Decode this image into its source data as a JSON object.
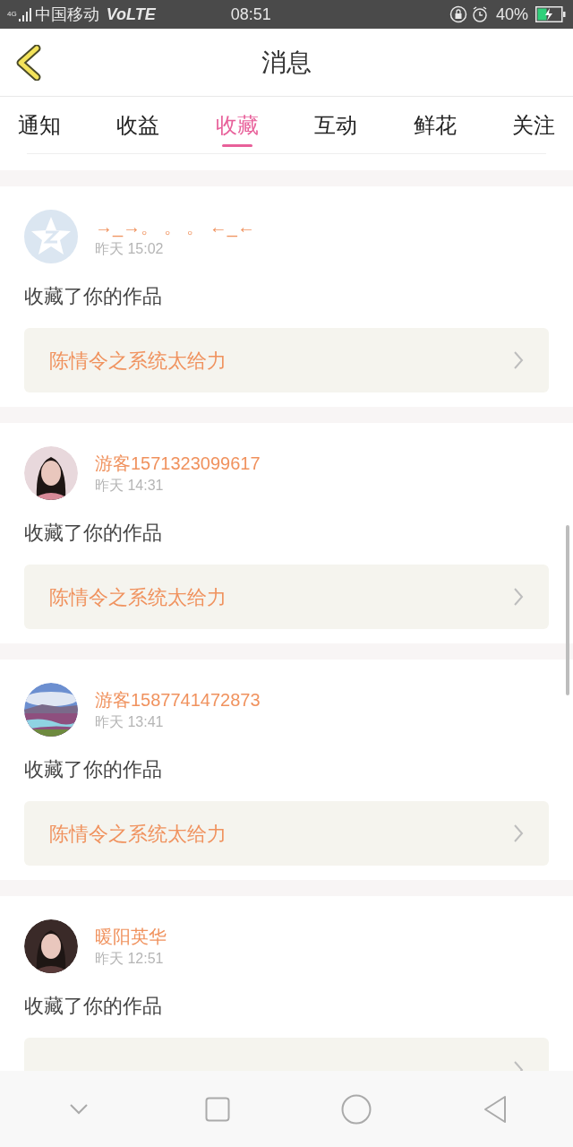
{
  "status_bar": {
    "network": "4G",
    "carrier": "中国移动",
    "volte": "VoLTE",
    "time": "08:51",
    "battery": "40%",
    "charging": true
  },
  "header": {
    "title": "消息"
  },
  "tabs": [
    {
      "label": "通知",
      "selected": false
    },
    {
      "label": "收益",
      "selected": false
    },
    {
      "label": "收藏",
      "selected": true
    },
    {
      "label": "互动",
      "selected": false
    },
    {
      "label": "鲜花",
      "selected": false
    },
    {
      "label": "关注",
      "selected": false
    }
  ],
  "messages": [
    {
      "kind": "default",
      "user": "→_→。 。 。 ←_←",
      "time": "昨天 15:02",
      "action": "收藏了你的作品",
      "work": "陈情令之系统太给力"
    },
    {
      "kind": "portrait",
      "user": "游客1571323099617",
      "time": "昨天 14:31",
      "action": "收藏了你的作品",
      "work": "陈情令之系统太给力"
    },
    {
      "kind": "landscape",
      "user": "游客1587741472873",
      "time": "昨天 13:41",
      "action": "收藏了你的作品",
      "work": "陈情令之系统太给力"
    },
    {
      "kind": "portrait",
      "user": "暖阳英华",
      "time": "昨天 12:51",
      "action": "收藏了你的作品"
    }
  ]
}
